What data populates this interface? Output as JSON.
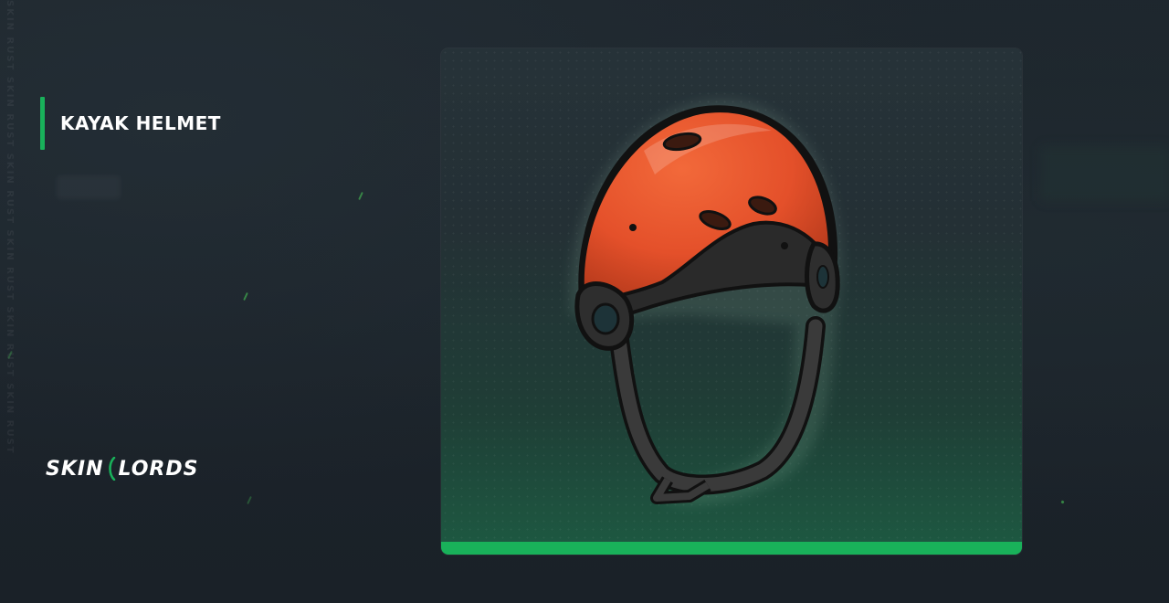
{
  "item": {
    "name": "KAYAK HELMET"
  },
  "brand": {
    "left": "SKIN",
    "right": "LORDS"
  },
  "watermark": "SKIN RUST SKIN RUST SKIN RUST SKIN RUST SKIN RUST SKIN RUST",
  "colors": {
    "accent": "#19b15a",
    "background": "#1c232a",
    "helmet_shell": "#e8542a",
    "helmet_strap": "#2b2b2b"
  },
  "icons": {
    "item_image": "kayak-helmet-icon",
    "logo_mark": "slash-logo-icon"
  }
}
